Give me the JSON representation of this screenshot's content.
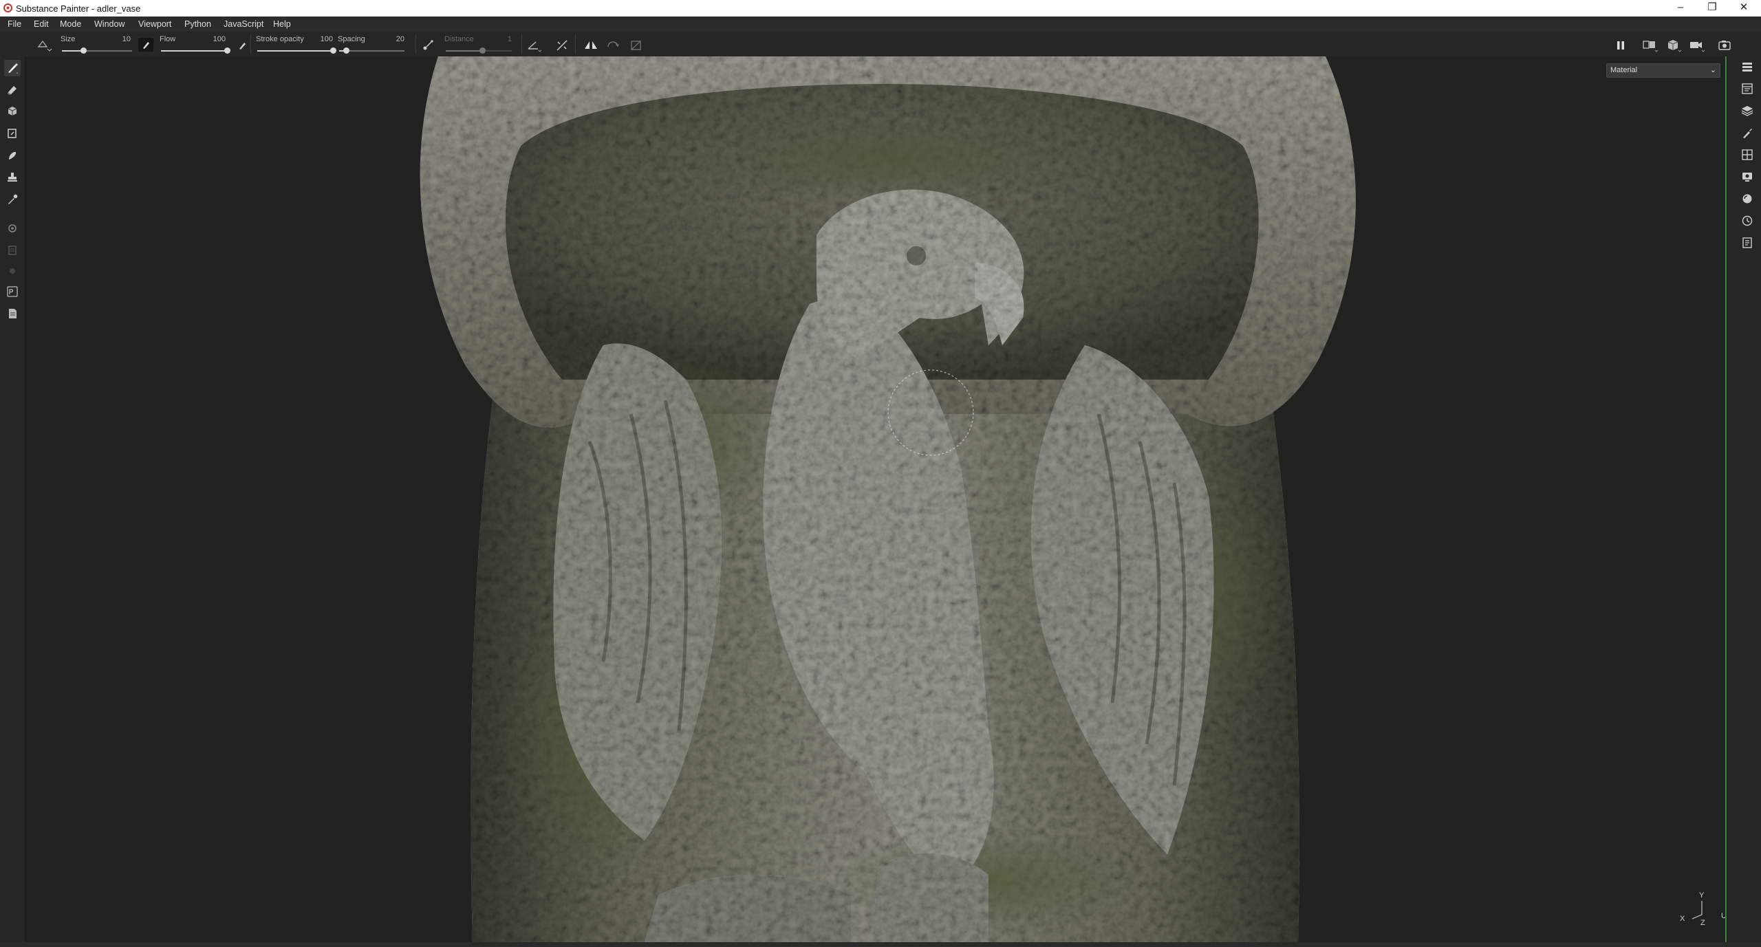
{
  "window": {
    "title": "Substance Painter - adler_vase",
    "minimize": "–",
    "restore": "❐",
    "close": "✕"
  },
  "menu": [
    "File",
    "Edit",
    "Mode",
    "Window",
    "Viewport",
    "Python",
    "JavaScript",
    "Help"
  ],
  "tool_options": {
    "size": {
      "label": "Size",
      "value": "10",
      "level": 0.3
    },
    "flow": {
      "label": "Flow",
      "value": "100",
      "level": 1.0
    },
    "stroke_opacity": {
      "label": "Stroke opacity",
      "value": "100",
      "level": 1.0
    },
    "spacing": {
      "label": "Spacing",
      "value": "20",
      "level": 0.1
    },
    "distance": {
      "label": "Distance",
      "value": "1",
      "level": 0.55
    }
  },
  "left_tools": [
    "paint-brush-icon",
    "eraser-icon",
    "projection-icon",
    "polygon-fill-icon",
    "smudge-icon",
    "clone-stamp-icon",
    "color-picker-icon",
    "bake-icon",
    "export-icon",
    "share-icon",
    "photoshop-icon",
    "texture-set-icon"
  ],
  "right_panels": [
    "layers-stack-icon",
    "properties-icon",
    "layer-icon",
    "brush-panel-icon",
    "texture-set-list-icon",
    "display-settings-icon",
    "shader-settings-icon",
    "history-icon",
    "log-icon"
  ],
  "viewport": {
    "channel": "Material",
    "axis": {
      "x": "X",
      "y": "Y",
      "z": "Z",
      "u": "U"
    }
  },
  "colors": {
    "background": "#212121",
    "accent": "#3a8a3a",
    "stone": "#8a8a80",
    "moss": "#5e6242"
  }
}
